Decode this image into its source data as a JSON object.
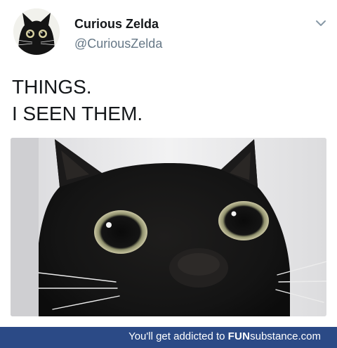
{
  "tweet": {
    "display_name": "Curious Zelda",
    "handle": "@CuriousZelda",
    "text_lines": [
      "THINGS.",
      "I SEEN THEM."
    ],
    "avatar_icon": "black-cat-avatar",
    "caret_icon": "chevron-down-icon",
    "media_description": "black cat close-up photo"
  },
  "footer": {
    "prefix": "You'll get addicted to",
    "brand_strong": "FUN",
    "brand_rest": "substance.com"
  },
  "colors": {
    "name": "#14171a",
    "handle": "#657786",
    "footer_bg": "#2b4a86"
  }
}
